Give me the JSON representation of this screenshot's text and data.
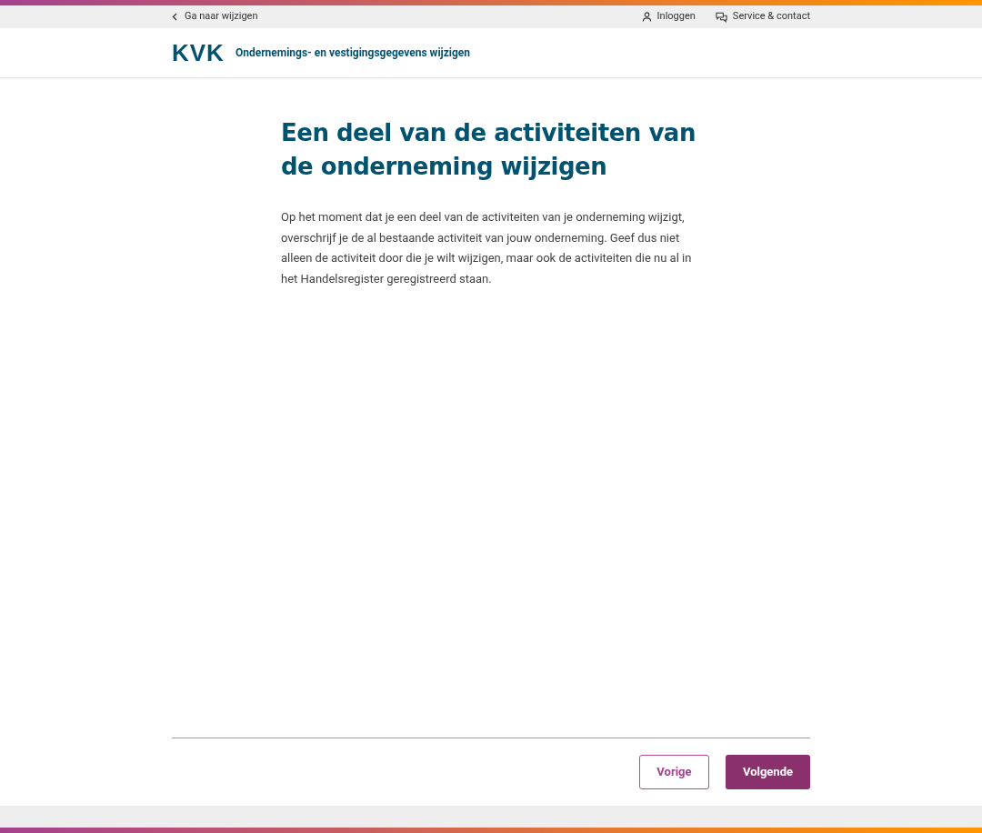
{
  "top_bar": {
    "back_link": "Ga naar wijzigen",
    "links": [
      {
        "kind": "user",
        "label": "Inloggen"
      },
      {
        "kind": "chat",
        "label": "Service & contact"
      }
    ]
  },
  "header": {
    "logo": "KVK",
    "title": "Ondernemings- en vestigingsgegevens wijzigen"
  },
  "main": {
    "heading": "Een deel van de activiteiten van de onderneming wijzigen",
    "paragraph": "Op het moment dat je een deel van de activiteiten van je onderneming wijzigt, overschrijf je de al bestaande activiteit van jouw onderneming. Geef dus niet alleen de activiteit door die je wilt wijzigen, maar ook de activiteiten die nu al in het Handelsregister geregistreerd staan."
  },
  "buttons": [
    {
      "kind": "secondary",
      "label": "Vorige"
    },
    {
      "kind": "primary",
      "label": "Volgende"
    }
  ]
}
